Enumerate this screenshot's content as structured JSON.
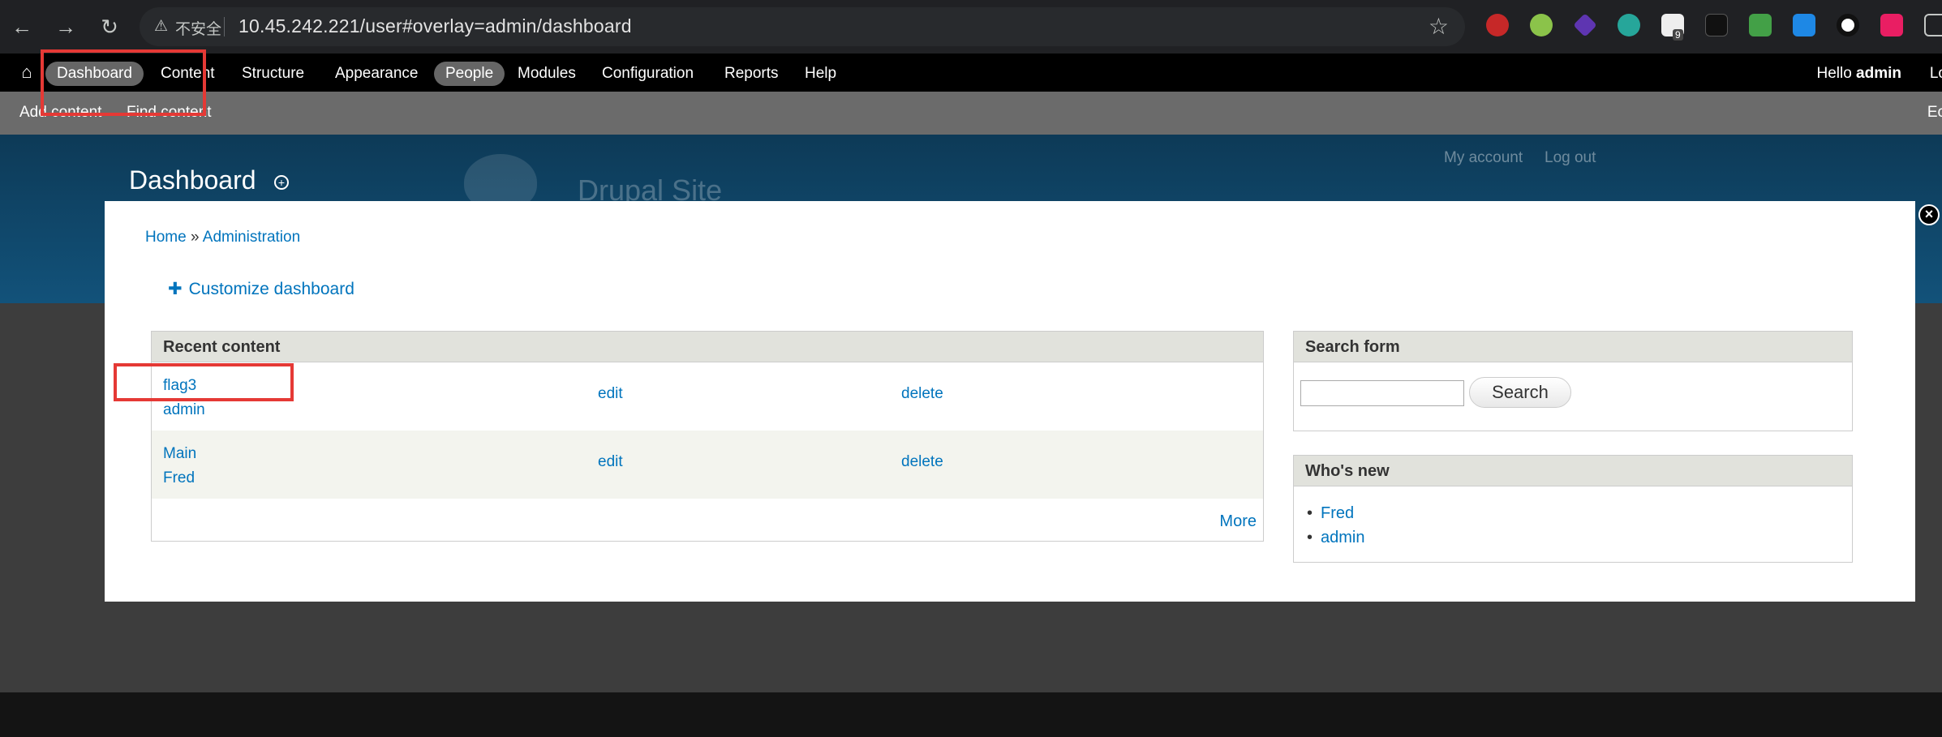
{
  "browser": {
    "insecure_label": "不安全",
    "url": "10.45.242.221/user#overlay=admin/dashboard",
    "ext_badge_count": "9"
  },
  "toolbar": {
    "items": [
      "Dashboard",
      "Content",
      "Structure",
      "Appearance",
      "People",
      "Modules",
      "Configuration",
      "Reports",
      "Help"
    ],
    "hello_prefix": "Hello ",
    "user": "admin",
    "logout_partial": "Lo"
  },
  "shortcuts": {
    "add_content": "Add content",
    "find_content": "Find content",
    "edit_partial": "Ec"
  },
  "background": {
    "page_title": "Dashboard",
    "site_name": "Drupal Site",
    "my_account": "My account",
    "log_out": "Log out"
  },
  "overlay": {
    "breadcrumb": {
      "home": "Home",
      "sep": " » ",
      "admin": "Administration"
    },
    "customize": "Customize dashboard",
    "recent_content": {
      "title": "Recent content",
      "rows": [
        {
          "title": "flag3",
          "author": "admin",
          "edit": "edit",
          "delete": "delete"
        },
        {
          "title": "Main",
          "author": "Fred",
          "edit": "edit",
          "delete": "delete"
        }
      ],
      "more": "More"
    },
    "search_form": {
      "title": "Search form",
      "button": "Search",
      "value": ""
    },
    "whos_new": {
      "title": "Who's new",
      "users": [
        "Fred",
        "admin"
      ]
    }
  }
}
